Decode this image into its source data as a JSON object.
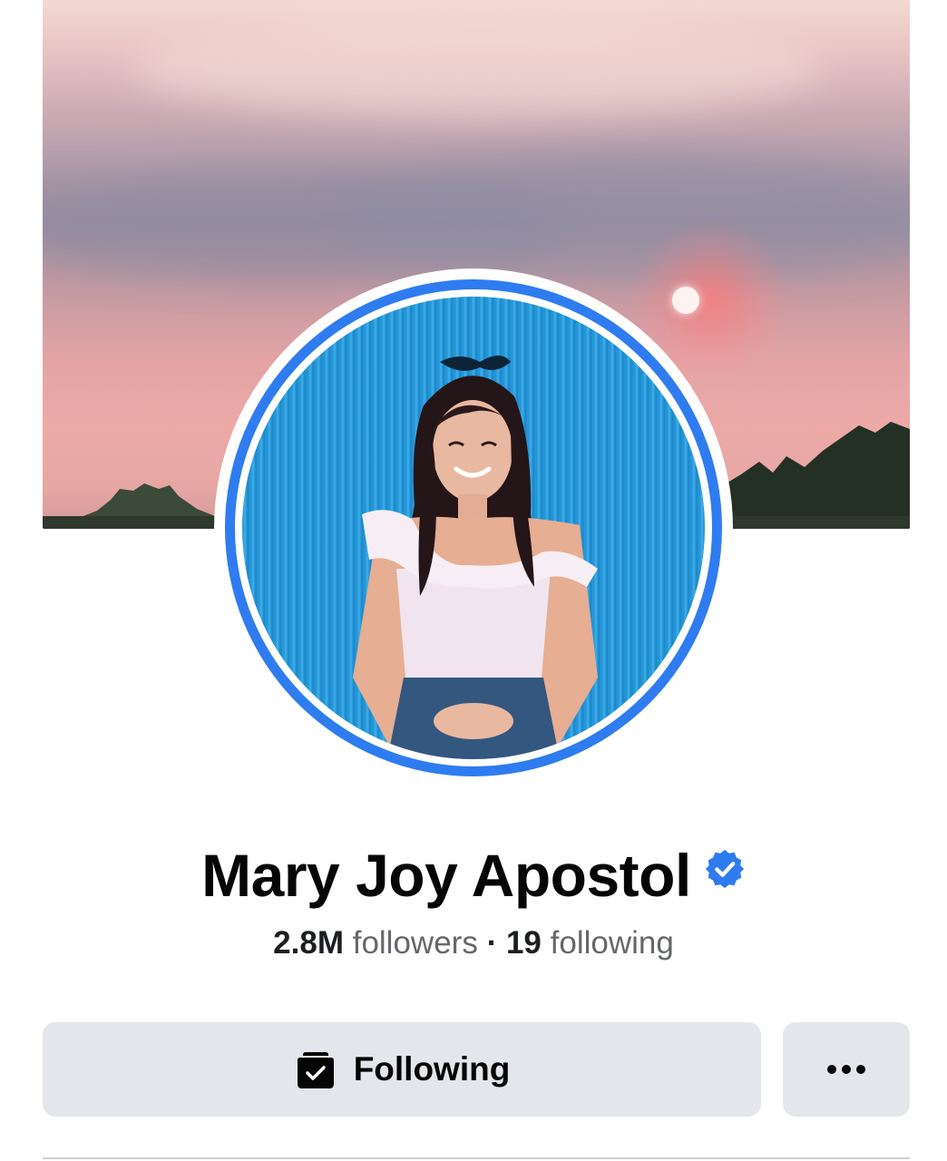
{
  "profile": {
    "name": "Mary Joy Apostol",
    "verified": true
  },
  "stats": {
    "followers_count": "2.8M",
    "followers_label": "followers",
    "separator": "·",
    "following_count": "19",
    "following_label": "following"
  },
  "actions": {
    "following_label": "Following",
    "following_icon": "following-check-icon",
    "more_icon": "more-dots-icon"
  },
  "colors": {
    "verified_blue": "#2f7cf0",
    "button_bg": "#e4e6eb",
    "name_text": "#050505",
    "secondary_text": "#65676b"
  }
}
